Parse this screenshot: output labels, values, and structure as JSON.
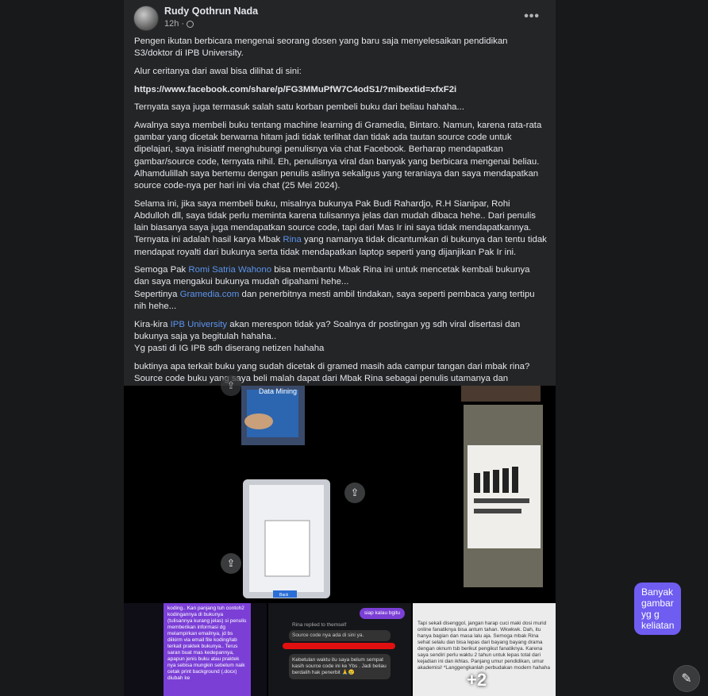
{
  "post": {
    "author": "Rudy Qothrun Nada",
    "time": "12h",
    "more_label": "•••",
    "paragraphs": {
      "p1": "Pengen ikutan berbicara mengenai seorang dosen yang baru saja menyelesaikan pendidikan S3/doktor di IPB University.",
      "p2": "Alur ceritanya dari awal bisa dilihat di sini:",
      "p3": "https://www.facebook.com/share/p/FG3MMuPfW7C4odS1/?mibextid=xfxF2i",
      "p4": "Ternyata saya juga termasuk salah satu korban pembeli buku dari beliau hahaha...",
      "p5": "Awalnya saya membeli buku tentang machine learning di Gramedia, Bintaro. Namun, karena rata-rata gambar yang dicetak berwarna hitam jadi tidak terlihat dan tidak ada tautan source code untuk dipelajari, saya inisiatif menghubungi penulisnya via chat Facebook. Berharap mendapatkan gambar/source code, ternyata nihil. Eh, penulisnya viral dan banyak yang berbicara mengenai beliau. Alhamdulillah saya bertemu dengan penulis aslinya sekaligus yang teraniaya dan saya mendapatkan source code-nya per hari ini via chat (25 Mei 2024).",
      "p6a": "Selama ini, jika saya membeli buku, misalnya bukunya Pak Budi Rahardjo, R.H Sianipar, Rohi Abdulloh dll, saya tidak perlu meminta karena tulisannya jelas dan mudah dibaca hehe.. Dari penulis lain biasanya saya juga mendapatkan source code, tapi dari Mas Ir ini saya tidak mendapatkannya. Ternyata ini adalah hasil karya Mbak ",
      "p6_mention": "Rina",
      "p6b": "  yang namanya tidak dicantumkan di bukunya dan tentu tidak mendapat royalti dari bukunya serta tidak mendapatkan laptop seperti yang dijanjikan Pak Ir ini.",
      "p7a": "Semoga Pak ",
      "p7_mention": "Romi Satria Wahono",
      "p7b": "  bisa membantu Mbak Rina ini untuk mencetak kembali bukunya  dan saya mengakui bukunya mudah dipahami hehe...",
      "p7c": "Sepertinya ",
      "p7_mention2": "Gramedia.com",
      "p7d": "  dan penerbitnya mesti ambil tindakan, saya seperti pembaca yang tertipu nih hehe...",
      "p8a": "Kira-kira ",
      "p8_mention": "IPB University",
      "p8b": "  akan merespon tidak ya? Soalnya dr postingan yg sdh viral disertasi dan bukunya saja ya begitulah hahaha..",
      "p8c": "Yg pasti di IG IPB sdh diserang netizen hahaha",
      "p9": "buktinya apa terkait buku yang sudah dicetak di gramed masih ada campur tangan dari mbak rina? Source code buku yang saya beli malah dapat dari Mbak Rina sebagai penulis utamanya dan namanya tidak tercantum dibuku itu...."
    }
  },
  "media": {
    "bubble_text": "Banyak gambar yg g keliatan",
    "book_title": "Data Mining",
    "phone_button": "Back",
    "more_count": "+2",
    "chat1": "koding.. Kan panjang tuh contoh2 kodingannya di bukunya (tulisannya kurang jelas) si penulis memberikan informasi dg melampirkan emailnya, jd bs diikirm via email file koding/lab terkait praktek bukunya.. Terus saran buat mas kedepannya, apapun jenis buku atau praktek nya sebisa mungkin sebelum naik cetak print background (.docx) diubah ke",
    "chat2_pill": "siap kalau bgitu",
    "chat2_reply": "Rina replied to themself",
    "chat2_q": "Source code nya ada di sini ya.",
    "chat2_msg": "Kebetulan waktu itu saya belum sempat kasih source code ini ke Ybs . Jadi beliau berdalih hak penerbit 🙏😢",
    "chat3": "Tapi sekali disenggol, jangan harap cuci maki dosi murid online fanatiknya bisa antum tahan. Wkwkwk. Dah, itu hanya bagian dan masa lalu aja. Semoga mbak Rina sehat selalu dan bisa lepas dari bayang bayang drama dengan oknum tsb berikut pengikut fanatiknya. Karena saya sendiri perlu waktu 2 tahun untuk lepas total dari kejadian ini dan ikhlas. Panjang umur pendidikan, umur akademisi! *Langgengkanlah perbudakan modern hahaha"
  },
  "colors": {
    "background": "#18191a",
    "card": "#242526",
    "mention": "#5b94ef",
    "bubble": "#6f5cf0"
  },
  "icons": [
    "more-icon",
    "globe-icon",
    "share-icon",
    "edit-icon"
  ]
}
